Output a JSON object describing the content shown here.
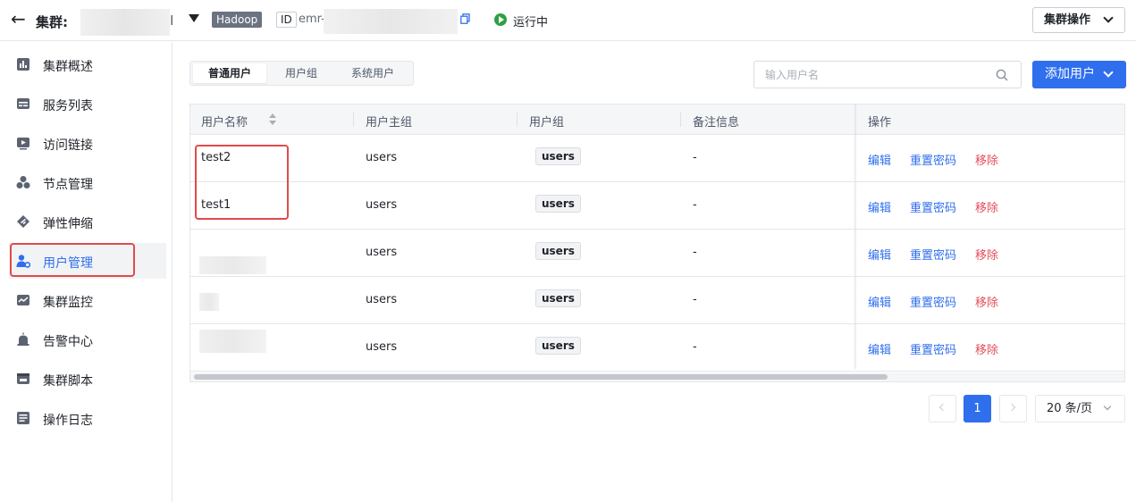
{
  "header": {
    "cluster_label": "集群:",
    "cluster_name_tail": "І",
    "engine_tag": "Hadoop",
    "id_tag": "ID",
    "id_prefix": "emr-",
    "status": "运行中",
    "status_color": "#2ea043",
    "cluster_ops_label": "集群操作"
  },
  "sidebar": {
    "items": [
      {
        "label": "集群概述",
        "icon": "bar-chart-icon"
      },
      {
        "label": "服务列表",
        "icon": "list-icon"
      },
      {
        "label": "访问链接",
        "icon": "play-screen-icon"
      },
      {
        "label": "节点管理",
        "icon": "nodes-icon"
      },
      {
        "label": "弹性伸缩",
        "icon": "scale-icon"
      },
      {
        "label": "用户管理",
        "icon": "user-gear-icon"
      },
      {
        "label": "集群监控",
        "icon": "monitor-icon"
      },
      {
        "label": "告警中心",
        "icon": "alarm-icon"
      },
      {
        "label": "集群脚本",
        "icon": "script-icon"
      },
      {
        "label": "操作日志",
        "icon": "log-icon"
      }
    ],
    "active_index": 5
  },
  "tabs": [
    "普通用户",
    "用户组",
    "系统用户"
  ],
  "search": {
    "placeholder": "输入用户名"
  },
  "add_button": "添加用户",
  "table": {
    "columns": [
      "用户名称",
      "用户主组",
      "用户组",
      "备注信息",
      "操作"
    ],
    "rows": [
      {
        "name": "test2",
        "primary_group": "users",
        "group": "users",
        "remark": "-"
      },
      {
        "name": "test1",
        "primary_group": "users",
        "group": "users",
        "remark": "-"
      },
      {
        "name": "",
        "primary_group": "users",
        "group": "users",
        "remark": "-"
      },
      {
        "name": "",
        "primary_group": "users",
        "group": "users",
        "remark": "-"
      },
      {
        "name": "",
        "primary_group": "users",
        "group": "users",
        "remark": "-"
      }
    ],
    "actions": {
      "edit": "编辑",
      "reset": "重置密码",
      "remove": "移除"
    }
  },
  "pagination": {
    "current": "1",
    "page_size": "20 条/页"
  },
  "colors": {
    "accent": "#2f6fed",
    "danger": "#e34d59",
    "highlight_box": "#e24a4a"
  }
}
